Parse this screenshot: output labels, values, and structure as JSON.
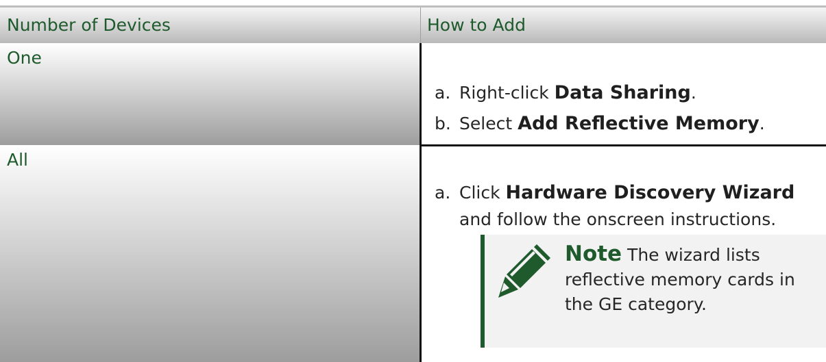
{
  "table": {
    "headers": [
      "Number of Devices",
      "How to Add"
    ],
    "rows": [
      {
        "device": "One",
        "steps": [
          {
            "label": "a.",
            "prefix": "Right-click ",
            "bold": "Data Sharing",
            "suffix": "."
          },
          {
            "label": "b.",
            "prefix": "Select ",
            "bold": "Add Reflective Memory",
            "suffix": "."
          }
        ]
      },
      {
        "device": "All",
        "steps": [
          {
            "label": "a.",
            "prefix": "Click ",
            "bold": "Hardware Discovery Wizard",
            "suffix": "",
            "continuation": "and follow the onscreen instructions."
          }
        ],
        "note": {
          "title": "Note",
          "text": "The wizard lists reflective memory cards in the GE category."
        }
      }
    ]
  },
  "colors": {
    "header_text": "#1e5a2c",
    "note_bar": "#1e5a2c",
    "divider": "#111111"
  },
  "icons": {
    "note": "pencil-icon"
  }
}
